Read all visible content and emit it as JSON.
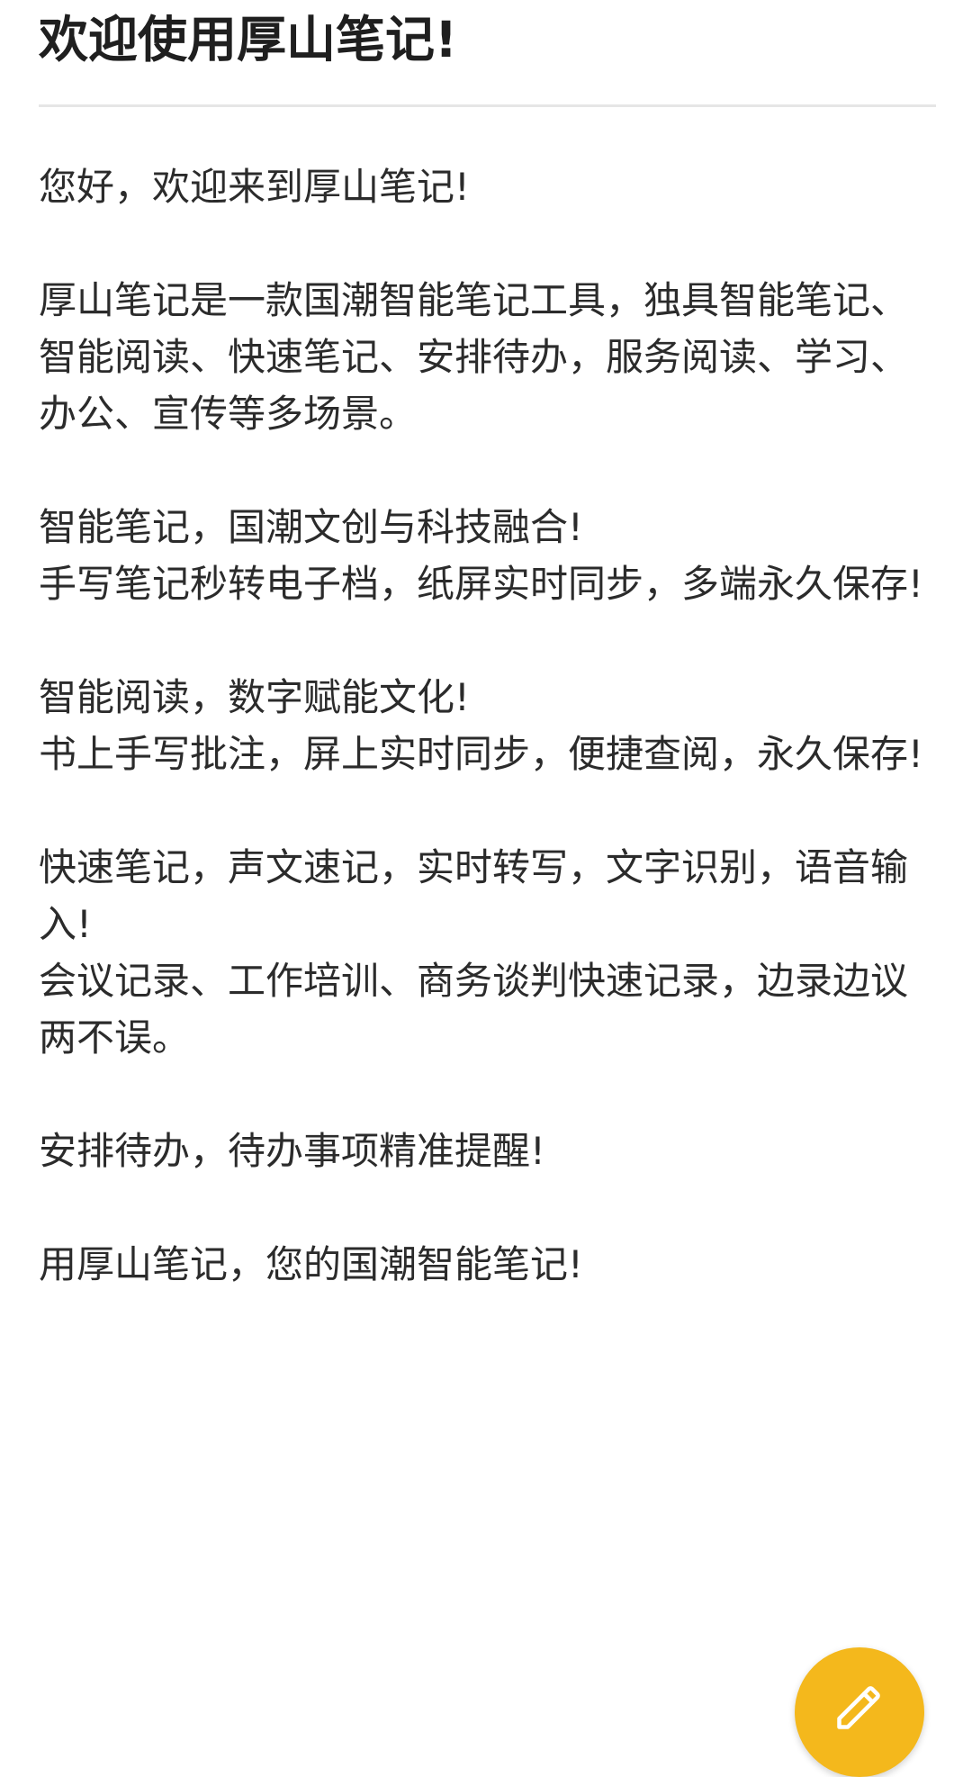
{
  "note": {
    "title": "欢迎使用厚山笔记!",
    "paragraphs": [
      "您好，欢迎来到厚山笔记!",
      "厚山笔记是一款国潮智能笔记工具，独具智能笔记、智能阅读、快速笔记、安排待办，服务阅读、学习、办公、宣传等多场景。",
      "智能笔记，国潮文创与科技融合!",
      "手写笔记秒转电子档，纸屏实时同步，多端永久保存!",
      "智能阅读，数字赋能文化!",
      "书上手写批注，屏上实时同步，便捷查阅，永久保存!",
      "快速笔记，声文速记，实时转写，文字识别，语音输入!",
      "会议记录、工作培训、商务谈判快速记录，边录边议两不误。",
      "安排待办，待办事项精准提醒!",
      "用厚山笔记，您的国潮智能笔记!"
    ]
  },
  "fab": {
    "icon": "pencil-icon",
    "color": "#f4b81c"
  }
}
